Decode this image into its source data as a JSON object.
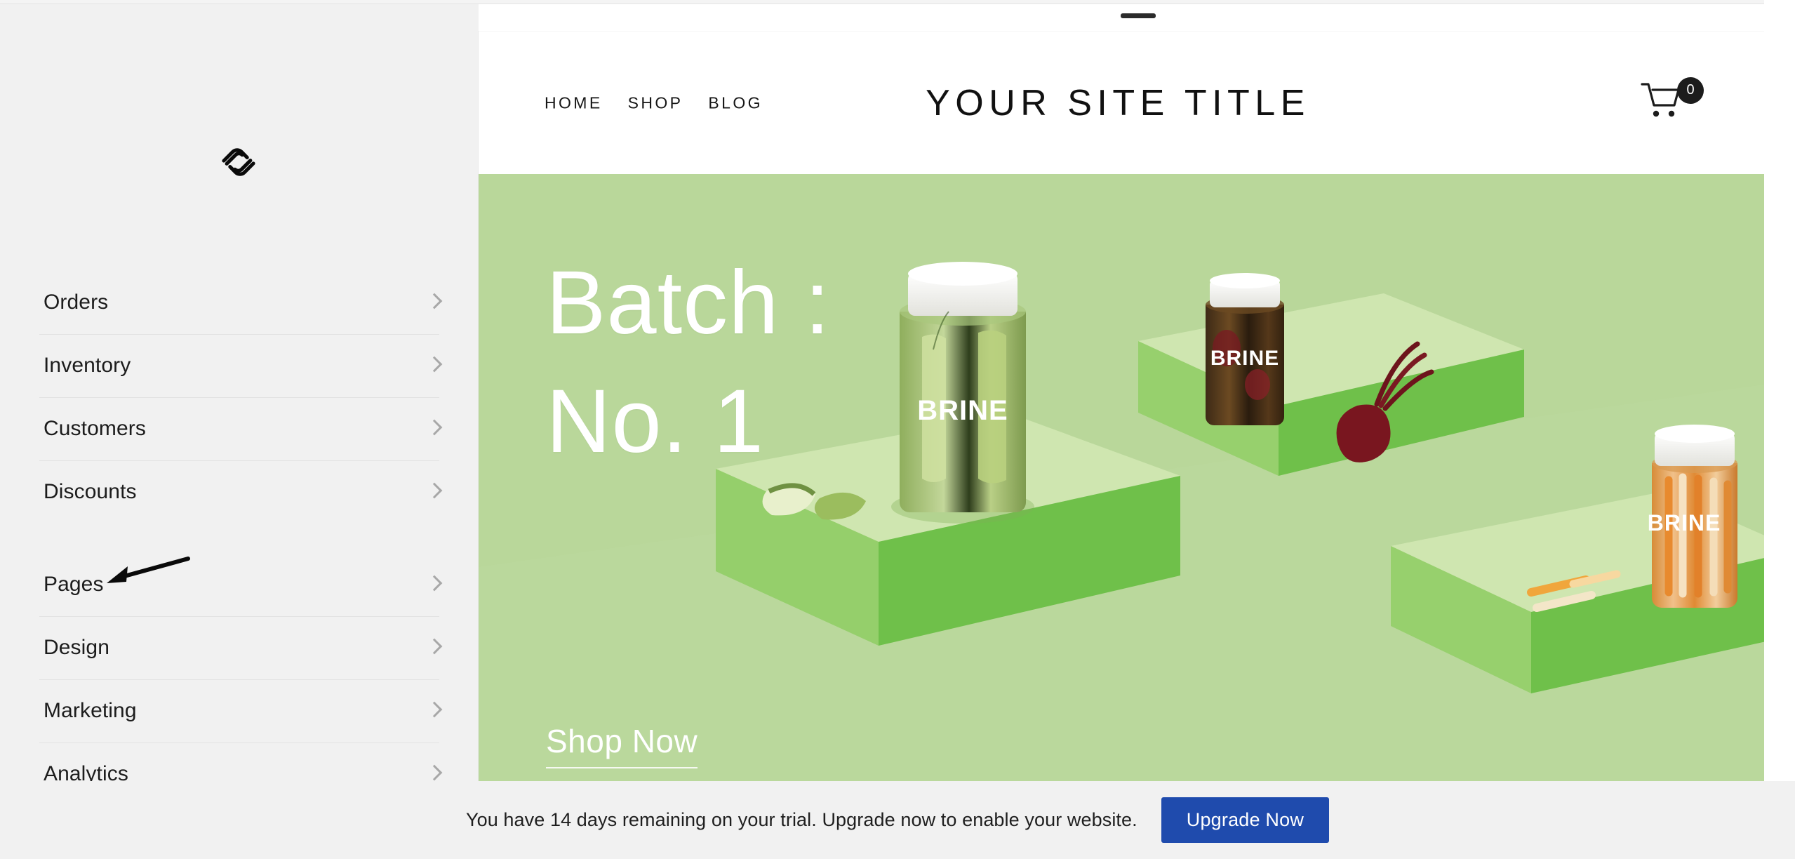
{
  "window": {
    "drag_handle": "drag-handle"
  },
  "sidebar": {
    "logo_name": "squarespace-logo",
    "groups": [
      {
        "items": [
          {
            "label": "Orders",
            "icon": "chevron-right-icon"
          },
          {
            "label": "Inventory",
            "icon": "chevron-right-icon"
          },
          {
            "label": "Customers",
            "icon": "chevron-right-icon"
          },
          {
            "label": "Discounts",
            "icon": "chevron-right-icon"
          }
        ]
      },
      {
        "items": [
          {
            "label": "Pages",
            "icon": "chevron-right-icon"
          },
          {
            "label": "Design",
            "icon": "chevron-right-icon"
          },
          {
            "label": "Marketing",
            "icon": "chevron-right-icon"
          },
          {
            "label": "Analytics",
            "icon": "chevron-right-icon"
          }
        ]
      }
    ],
    "annotation": {
      "name": "pointer-arrow-to-pages",
      "target": "Pages"
    }
  },
  "preview": {
    "site_header": {
      "nav": [
        {
          "label": "HOME"
        },
        {
          "label": "SHOP"
        },
        {
          "label": "BLOG"
        }
      ],
      "title": "YOUR SITE TITLE",
      "cart": {
        "icon": "shopping-cart-icon",
        "count": "0"
      }
    },
    "hero": {
      "heading_line1": "Batch :",
      "heading_line2": "No. 1",
      "cta": "Shop Now",
      "background_color": "#b9d79a",
      "product_label": "BRINE",
      "products": [
        {
          "name": "pickle-jar",
          "label": "BRINE"
        },
        {
          "name": "beet-jar",
          "label": "BRINE"
        },
        {
          "name": "carrot-jar",
          "label": "BRINE"
        }
      ]
    }
  },
  "trial": {
    "message": "You have 14 days remaining on your trial. Upgrade now to enable your website.",
    "button_label": "Upgrade Now",
    "button_color": "#1f4bad"
  }
}
